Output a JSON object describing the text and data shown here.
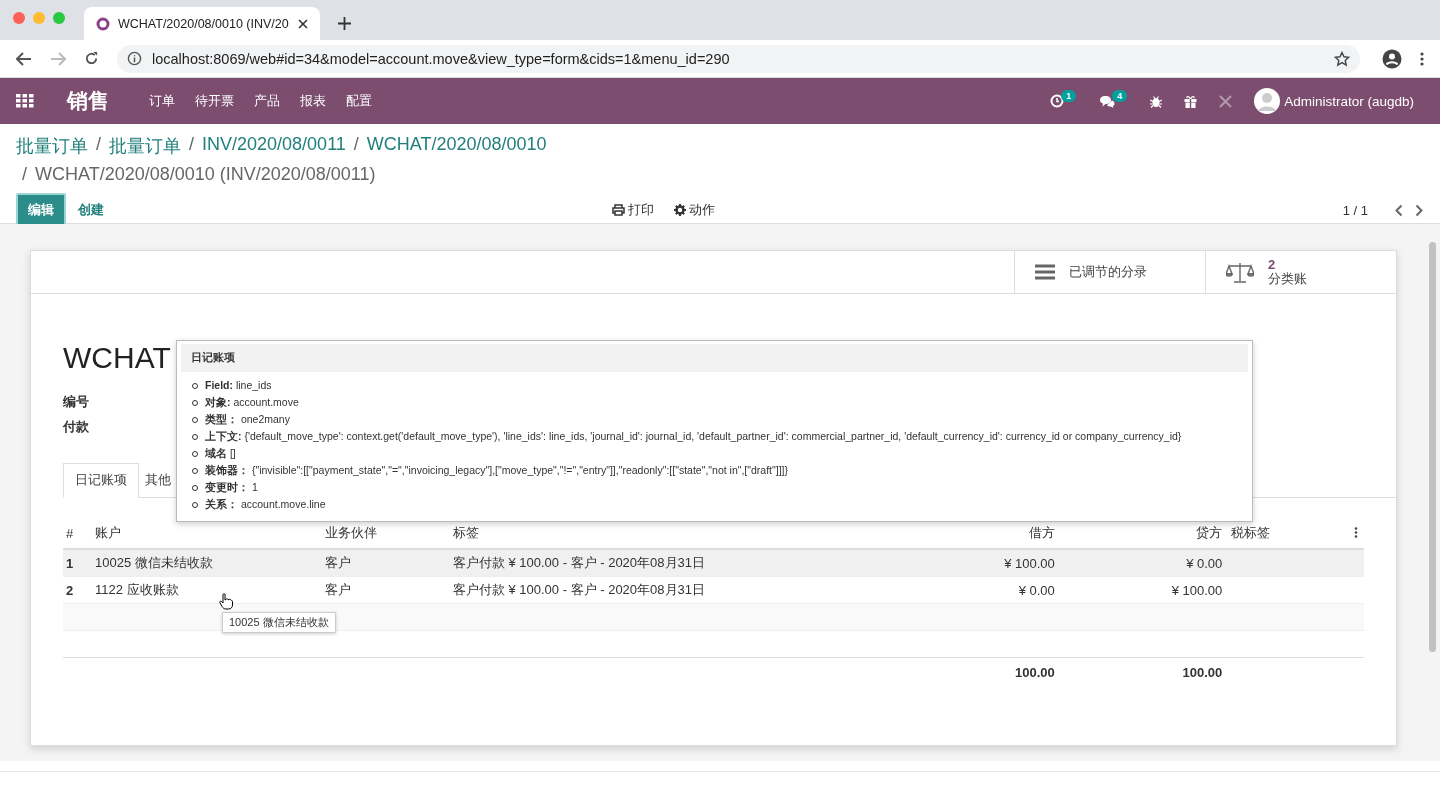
{
  "browser": {
    "tab_title": "WCHAT/2020/08/0010 (INV/20",
    "url": "localhost:8069/web#id=34&model=account.move&view_type=form&cids=1&menu_id=290"
  },
  "navbar": {
    "app_name": "销售",
    "menu": [
      "订单",
      "待开票",
      "产品",
      "报表",
      "配置"
    ],
    "activity_count": "1",
    "message_count": "4",
    "user": "Administrator (augdb)"
  },
  "breadcrumbs": {
    "separator": "/",
    "items": [
      "批量订单",
      "批量订单",
      "INV/2020/08/0011",
      "WCHAT/2020/08/0010"
    ],
    "current": "WCHAT/2020/08/0010 (INV/2020/08/0011)"
  },
  "control_panel": {
    "edit": "编辑",
    "create": "创建",
    "print": "打印",
    "action": "动作",
    "pager": "1 / 1"
  },
  "smart_buttons": [
    {
      "kind": "list",
      "label": "已调节的分录"
    },
    {
      "kind": "ledger",
      "count": "2",
      "label": "分类账"
    }
  ],
  "form": {
    "title": "WCHAT",
    "fields": [
      "编号",
      "付款"
    ],
    "tabs": [
      {
        "label": "日记账项",
        "selected": true
      },
      {
        "label": "其他",
        "selected": false
      }
    ]
  },
  "table": {
    "columns": [
      "#",
      "账户",
      "业务伙伴",
      "标签",
      "借方",
      "贷方",
      "税标签"
    ],
    "rows": [
      {
        "no": "1",
        "account": "10025 微信未结收款",
        "partner": "客户",
        "label": "客户付款 ¥ 100.00 - 客户 - 2020年08月31日",
        "debit": "¥ 100.00",
        "credit": "¥ 0.00",
        "highlighted": true
      },
      {
        "no": "2",
        "account": "1122 应收账款",
        "partner": "客户",
        "label": "客户付款 ¥ 100.00 - 客户 - 2020年08月31日",
        "debit": "¥ 0.00",
        "credit": "¥ 100.00",
        "highlighted": false
      }
    ],
    "total_debit": "100.00",
    "total_credit": "100.00"
  },
  "field_tooltip": {
    "title": "日记账项",
    "lines": [
      {
        "key": "Field:",
        "value": "line_ids"
      },
      {
        "key": "对象:",
        "value": "account.move"
      },
      {
        "key": "类型：",
        "value": "one2many"
      },
      {
        "key": "上下文:",
        "value": "{'default_move_type': context.get('default_move_type'), 'line_ids': line_ids, 'journal_id': journal_id, 'default_partner_id': commercial_partner_id, 'default_currency_id': currency_id or company_currency_id}"
      },
      {
        "key": "域名",
        "value": "[]"
      },
      {
        "key": "装饰器：",
        "value": "{\"invisible\":[[\"payment_state\",\"=\",\"invoicing_legacy\"],[\"move_type\",\"!=\",\"entry\"]],\"readonly\":[[\"state\",\"not in\",[\"draft\"]]]}"
      },
      {
        "key": "变更时：",
        "value": "1"
      },
      {
        "key": "关系：",
        "value": "account.move.line"
      }
    ]
  },
  "cell_tooltip": "10025 微信未结收款"
}
